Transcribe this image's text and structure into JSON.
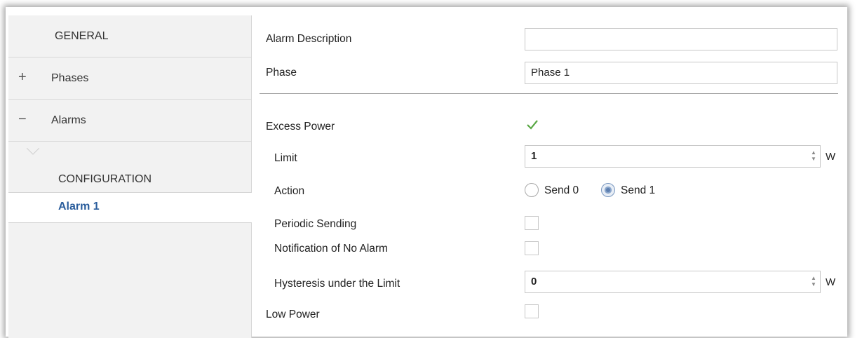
{
  "sidebar": {
    "items": [
      {
        "label": "GENERAL",
        "sign": ""
      },
      {
        "label": "Phases",
        "sign": "+"
      },
      {
        "label": "Alarms",
        "sign": "−"
      }
    ],
    "sub_items": [
      {
        "label": "CONFIGURATION",
        "selected": false
      },
      {
        "label": "Alarm 1",
        "selected": true
      }
    ]
  },
  "form": {
    "alarm_description": {
      "label": "Alarm Description",
      "value": ""
    },
    "phase": {
      "label": "Phase",
      "value": "Phase 1"
    },
    "excess_power": {
      "label": "Excess Power",
      "checked": true
    },
    "limit": {
      "label": "Limit",
      "value": "1",
      "unit": "W"
    },
    "action": {
      "label": "Action",
      "options": [
        "Send 0",
        "Send 1"
      ],
      "selected": "Send 1"
    },
    "periodic_sending": {
      "label": "Periodic Sending",
      "checked": false
    },
    "notification_no_alarm": {
      "label": "Notification of No Alarm",
      "checked": false
    },
    "hysteresis": {
      "label": "Hysteresis under the Limit",
      "value": "0",
      "unit": "W"
    },
    "low_power": {
      "label": "Low Power",
      "checked": false
    }
  },
  "colors": {
    "selected_text": "#2a5d9c",
    "check": "#5aa845",
    "sidebar_bg": "#f2f2f2"
  }
}
